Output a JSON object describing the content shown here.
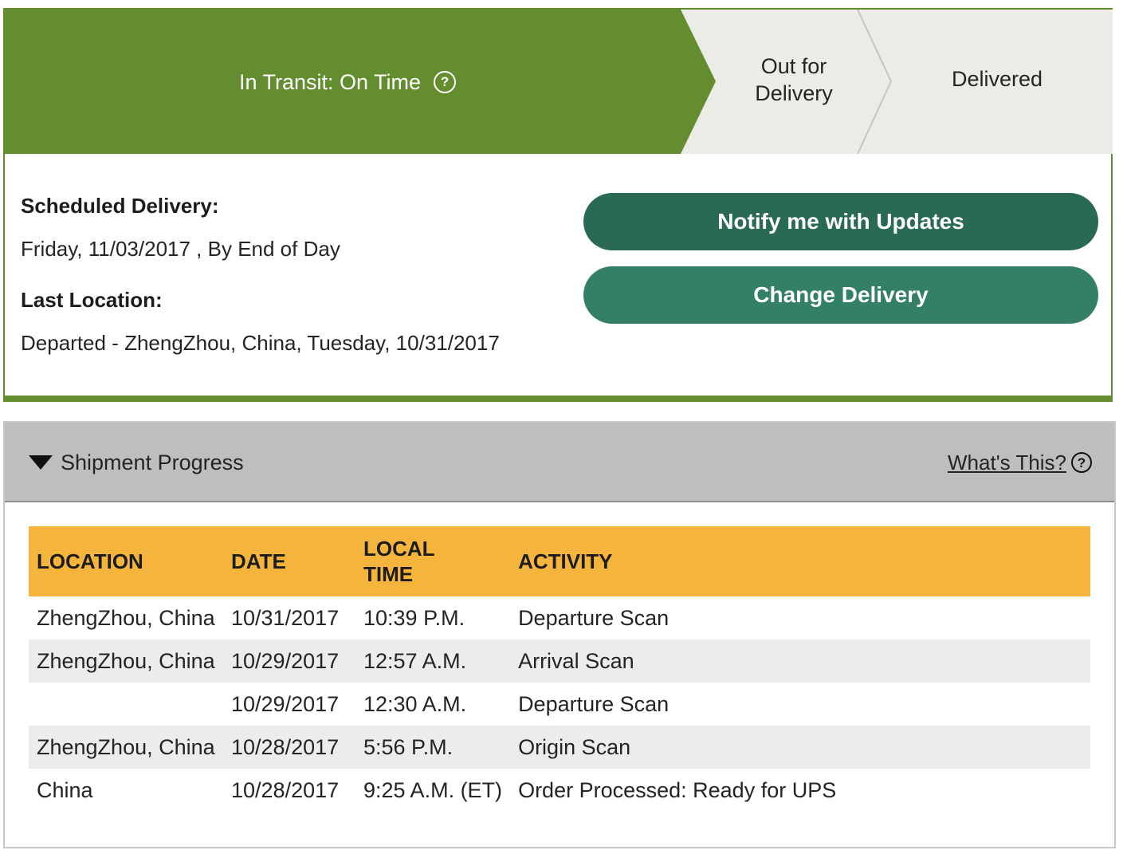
{
  "progress": {
    "current_step": "In Transit: On Time",
    "steps": [
      "Out for\nDelivery",
      "Delivered"
    ],
    "help_symbol": "?"
  },
  "summary": {
    "scheduled_label": "Scheduled Delivery:",
    "scheduled_value": "Friday, 11/03/2017 , By End of Day",
    "location_label": "Last Location:",
    "location_value": "Departed - ZhengZhou, China, Tuesday, 10/31/2017"
  },
  "actions": {
    "notify_label": "Notify me with Updates",
    "change_label": "Change Delivery"
  },
  "shipment_progress": {
    "title": "Shipment Progress",
    "whats_this": "What's This?",
    "columns": [
      "LOCATION",
      "DATE",
      "LOCAL\nTIME",
      "ACTIVITY"
    ],
    "rows": [
      [
        "ZhengZhou,  China",
        "10/31/2017",
        "10:39 P.M.",
        "Departure Scan"
      ],
      [
        "ZhengZhou,  China",
        "10/29/2017",
        "12:57 A.M.",
        "Arrival Scan"
      ],
      [
        "",
        "10/29/2017",
        "12:30 A.M.",
        "Departure Scan"
      ],
      [
        "ZhengZhou,  China",
        "10/28/2017",
        "5:56 P.M.",
        "Origin Scan"
      ],
      [
        "China",
        "10/28/2017",
        "9:25 A.M. (ET)",
        "Order Processed: Ready for UPS"
      ]
    ]
  },
  "colors": {
    "green": "#648d30",
    "step_bg": "#ecece7",
    "notify_button": "#2a6a53",
    "change_button": "#338066",
    "table_header": "#f5b53d",
    "panel_header": "#bebebe"
  },
  "icons": {
    "help": "question-circle-icon",
    "toggle": "triangle-down-icon"
  }
}
